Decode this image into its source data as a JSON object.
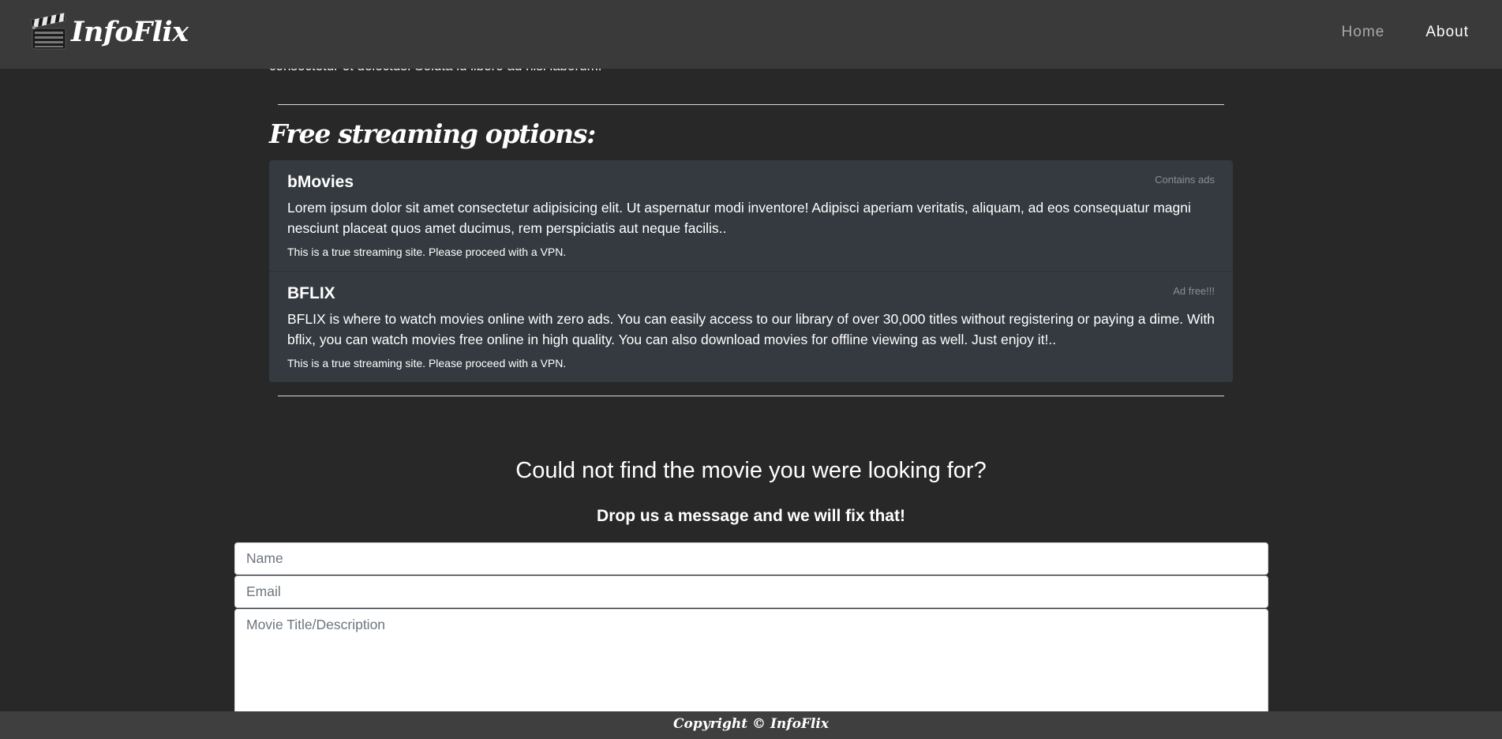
{
  "navbar": {
    "brand": "InfoFlix",
    "logo_icon": "clapperboard-icon",
    "links": {
      "home": "Home",
      "about": "About"
    }
  },
  "cut_text": "consectetur et delectus. Soluta id libero ad nisi laborum.",
  "section": {
    "heading": "Free streaming options:",
    "items": [
      {
        "title": "bMovies",
        "tag": "Contains ads",
        "description": "Lorem ipsum dolor sit amet consectetur adipisicing elit. Ut aspernatur modi inventore! Adipisci aperiam veritatis, aliquam, ad eos consequatur magni nesciunt placeat quos amet ducimus, rem perspiciatis aut neque facilis..",
        "note": "This is a true streaming site. Please proceed with a VPN."
      },
      {
        "title": "BFLIX",
        "tag": "Ad free!!!",
        "description": "BFLIX is where to watch movies online with zero ads. You can easily access to our library of over 30,000 titles without registering or paying a dime. With bflix, you can watch movies free online in high quality. You can also download movies for offline viewing as well. Just enjoy it!..",
        "note": "This is a true streaming site. Please proceed with a VPN."
      }
    ]
  },
  "contact": {
    "title": "Could not find the movie you were looking for?",
    "subtitle": "Drop us a message and we will fix that!",
    "name_placeholder": "Name",
    "email_placeholder": "Email",
    "movie_placeholder": "Movie Title/Description"
  },
  "footer": {
    "text": "Copyright © InfoFlix"
  },
  "colors": {
    "background": "#282828",
    "navbar": "#3a3a3a",
    "card": "#343a40",
    "footer": "#3f3f3f"
  }
}
